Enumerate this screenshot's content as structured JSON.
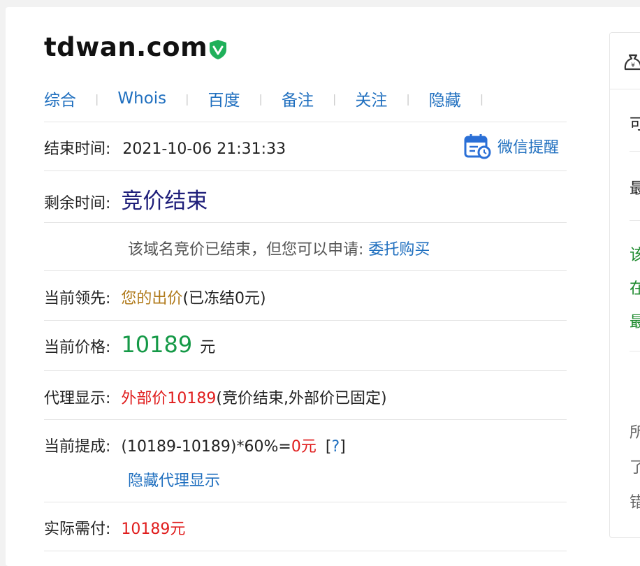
{
  "domain": "tdwan.com",
  "tabs": [
    "综合",
    "Whois",
    "百度",
    "备注",
    "关注",
    "隐藏"
  ],
  "end_time": {
    "label": "结束时间:",
    "value": "2021-10-06 21:31:33"
  },
  "wechat_remind": "微信提醒",
  "remaining": {
    "label": "剩余时间:",
    "value": "竞价结束"
  },
  "notice": {
    "text": "该域名竞价已结束，但您可以申请:",
    "link": "委托购买"
  },
  "leader": {
    "label": "当前领先:",
    "value": "您的出价",
    "suffix": "(已冻结0元)"
  },
  "price": {
    "label": "当前价格:",
    "value": "10189",
    "unit": "元"
  },
  "proxy": {
    "label": "代理显示:",
    "value": "外部价10189",
    "suffix": "(竞价结束,外部价已固定)"
  },
  "commission": {
    "label": "当前提成:",
    "formula": "(10189-10189)*60%=",
    "result": "0元",
    "help_open": "[",
    "help": "?",
    "help_close": "]",
    "hide_link": "隐藏代理显示"
  },
  "payable": {
    "label": "实际需付:",
    "value": "10189元"
  },
  "side": {
    "c1": "可",
    "c2": "最",
    "c3": "该",
    "c4": "在",
    "c5": "最",
    "c6": "所",
    "c7": "了",
    "c8": "错"
  },
  "colors": {
    "link": "#1f6fbf",
    "price": "#159947",
    "alert": "#e01d1d",
    "status": "#1f1f7a",
    "badge": "#1fb05a"
  }
}
